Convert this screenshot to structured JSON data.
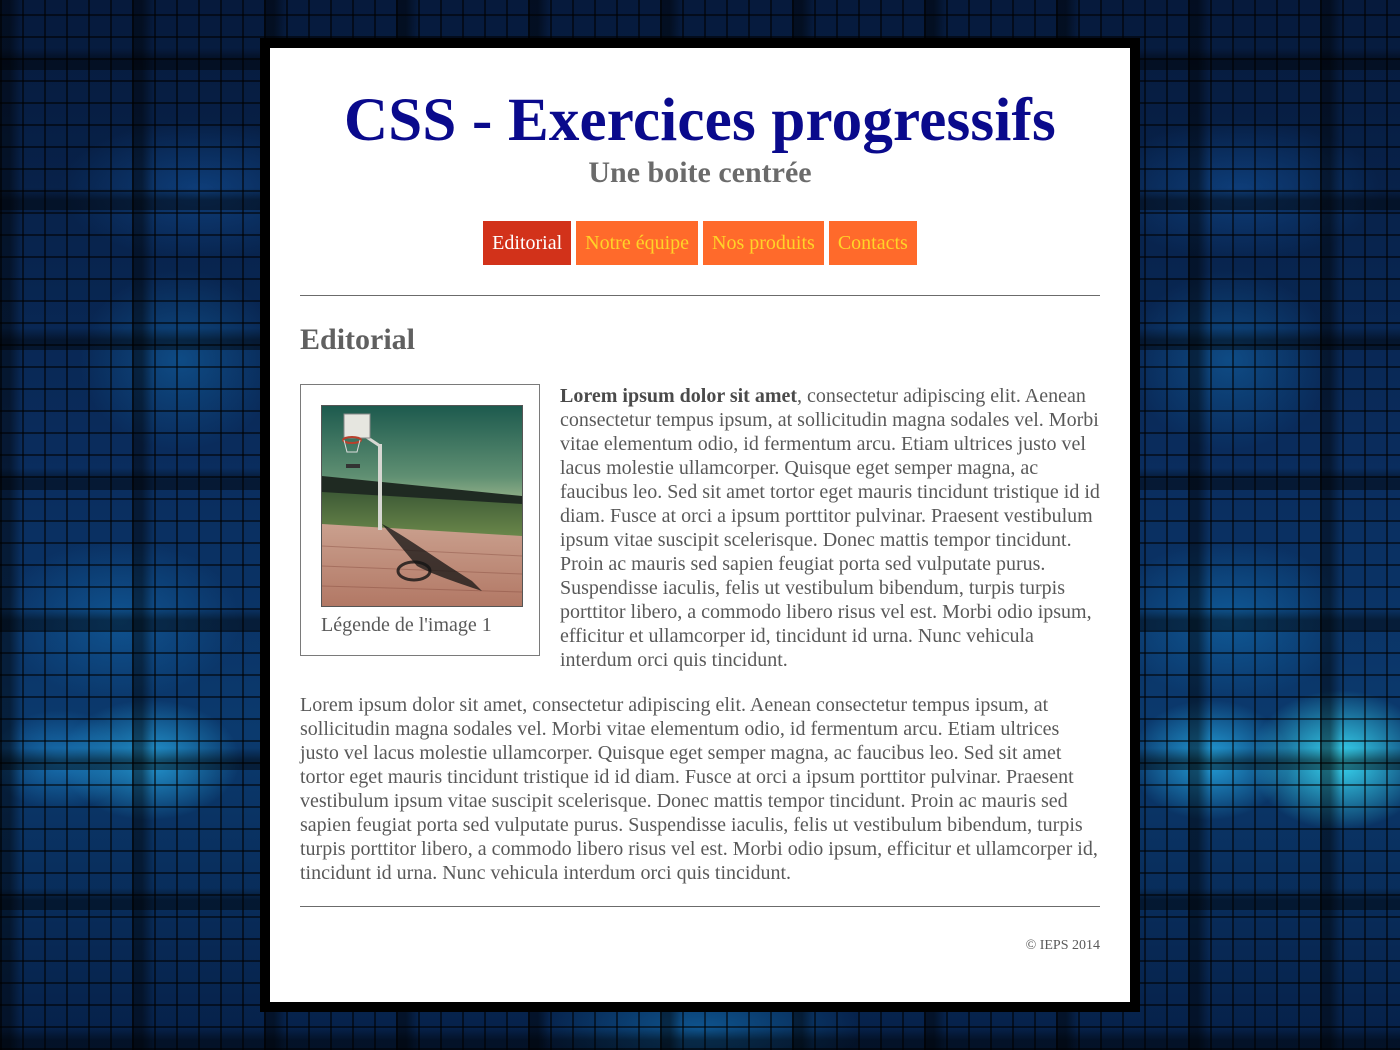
{
  "header": {
    "title": "CSS - Exercices progressifs",
    "subtitle": "Une boite centrée"
  },
  "nav": {
    "items": [
      {
        "label": "Editorial",
        "active": true
      },
      {
        "label": "Notre équipe",
        "active": false
      },
      {
        "label": "Nos produits",
        "active": false
      },
      {
        "label": "Contacts",
        "active": false
      }
    ]
  },
  "main": {
    "section_title": "Editorial",
    "figure": {
      "caption": "Légende de l'image 1"
    },
    "paragraph1": {
      "lead": "Lorem ipsum dolor sit amet",
      "text": ", consectetur adipiscing elit. Aenean consectetur tempus ipsum, at sollicitudin magna sodales vel. Morbi vitae elementum odio, id fermentum arcu. Etiam ultrices justo vel lacus molestie ullamcorper. Quisque eget semper magna, ac faucibus leo. Sed sit amet tortor eget mauris tincidunt tristique id id diam. Fusce at orci a ipsum porttitor pulvinar. Praesent vestibulum ipsum vitae suscipit scelerisque. Donec mattis tempor tincidunt. Proin ac mauris sed sapien feugiat porta sed vulputate purus. Suspendisse iaculis, felis ut vestibulum bibendum, turpis turpis porttitor libero, a commodo libero risus vel est. Morbi odio ipsum, efficitur et ullamcorper id, tincidunt id urna. Nunc vehicula interdum orci quis tincidunt."
    },
    "paragraph2": "Lorem ipsum dolor sit amet, consectetur adipiscing elit. Aenean consectetur tempus ipsum, at sollicitudin magna sodales vel. Morbi vitae elementum odio, id fermentum arcu. Etiam ultrices justo vel lacus molestie ullamcorper. Quisque eget semper magna, ac faucibus leo. Sed sit amet tortor eget mauris tincidunt tristique id id diam. Fusce at orci a ipsum porttitor pulvinar. Praesent vestibulum ipsum vitae suscipit scelerisque. Donec mattis tempor tincidunt. Proin ac mauris sed sapien feugiat porta sed vulputate purus. Suspendisse iaculis, felis ut vestibulum bibendum, turpis turpis porttitor libero, a commodo libero risus vel est. Morbi odio ipsum, efficitur et ullamcorper id, tincidunt id urna. Nunc vehicula interdum orci quis tincidunt."
  },
  "footer": {
    "copyright": "© IEPS 2014"
  },
  "colors": {
    "title": "#0a0a8c",
    "nav_active": "#d2321a",
    "nav_inactive": "#ff6a2b",
    "nav_inactive_text": "#ffd428"
  }
}
